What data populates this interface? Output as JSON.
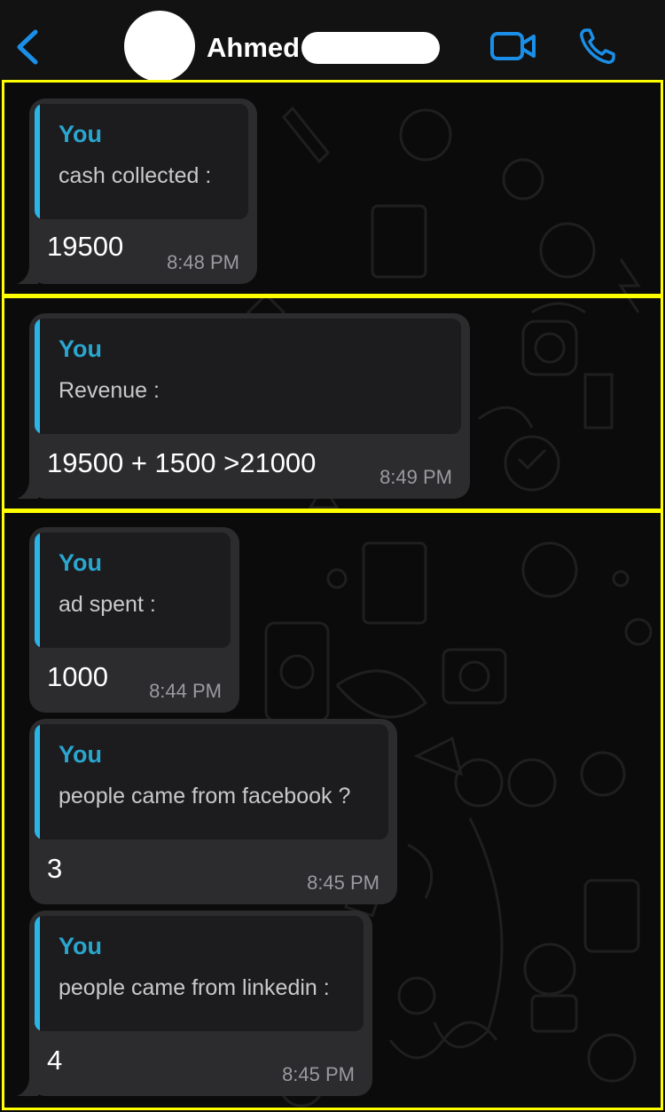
{
  "header": {
    "back_icon": "chevron-left-icon",
    "contact_name": "Ahmed",
    "video_icon": "video-camera-icon",
    "call_icon": "phone-icon",
    "accent_color": "#1b8fe8"
  },
  "messages": [
    {
      "quote_author": "You",
      "quote_text": "cash collected :",
      "text": "19500",
      "time": "8:48 PM"
    },
    {
      "quote_author": "You",
      "quote_text": "Revenue :",
      "text": "19500 + 1500 >21000",
      "time": "8:49 PM"
    },
    {
      "quote_author": "You",
      "quote_text": "ad spent :",
      "text": "1000",
      "time": "8:44 PM"
    },
    {
      "quote_author": "You",
      "quote_text": "people came from facebook ?",
      "text": "3",
      "time": "8:45 PM"
    },
    {
      "quote_author": "You",
      "quote_text": "people came from linkedin :",
      "text": "4",
      "time": "8:45 PM"
    }
  ],
  "colors": {
    "highlight_frame": "#ffff00",
    "bubble": "#2c2c2e",
    "quote_bar": "#2bb5e6",
    "quote_author": "#2aa6cf"
  }
}
